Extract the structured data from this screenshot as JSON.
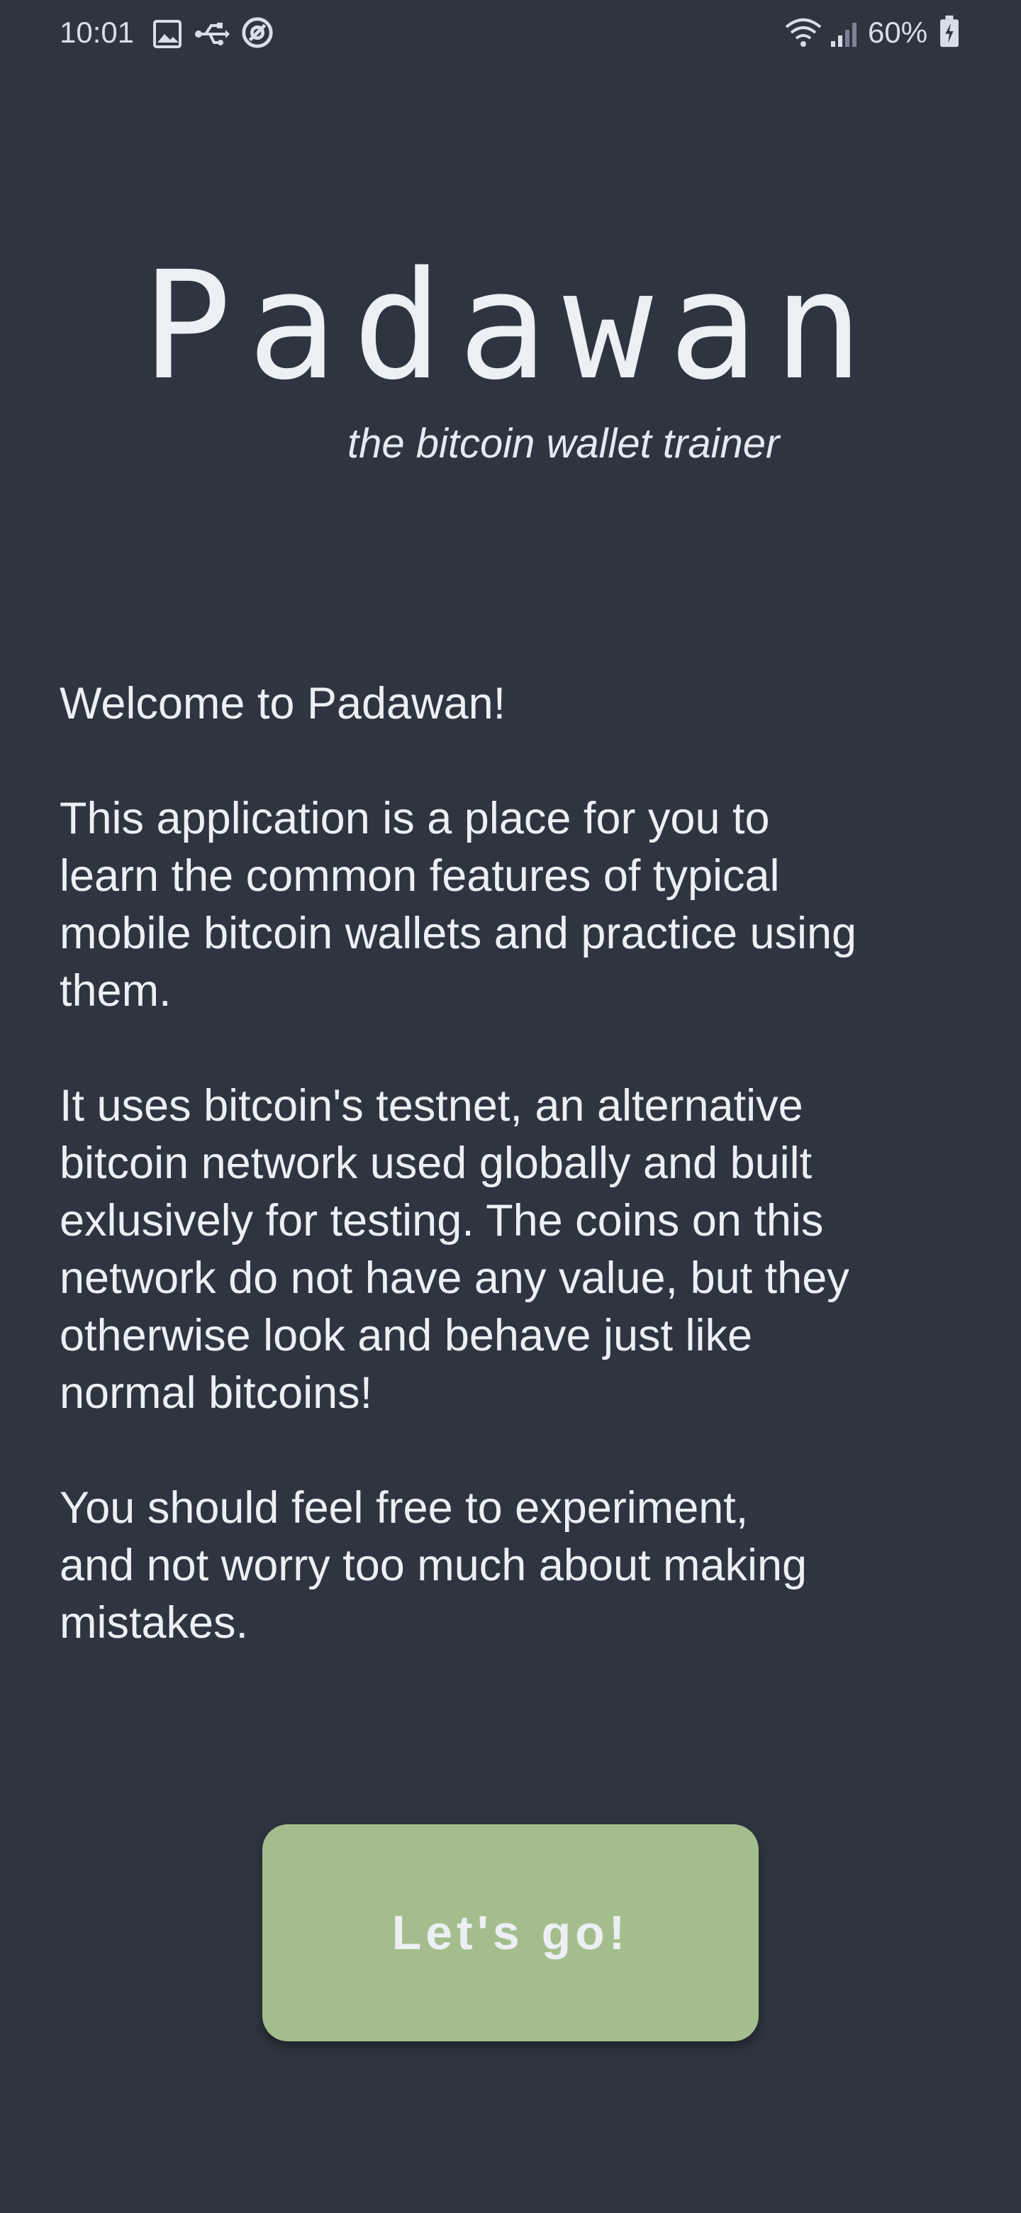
{
  "status_bar": {
    "time": "10:01",
    "battery_percent": "60%",
    "icons_left": [
      "image-icon",
      "usb-icon",
      "sync-icon"
    ],
    "icons_right": [
      "wifi-icon",
      "signal-icon",
      "battery-icon"
    ]
  },
  "header": {
    "title": "Padawan",
    "subtitle": "the bitcoin wallet trainer"
  },
  "intro": {
    "paragraphs": [
      "Welcome to Padawan!",
      "This application is a place for you to\nlearn the common features of typical\nmobile bitcoin wallets and practice using\nthem.",
      "It uses bitcoin's testnet, an alternative\nbitcoin network used globally and built\nexlusively for testing. The coins on this\nnetwork do not have any value, but they\notherwise look and behave just like\nnormal bitcoins!",
      "You should feel free to experiment,\nand not worry too much about making\nmistakes."
    ]
  },
  "cta": {
    "label": "Let's go!"
  },
  "colors": {
    "background": "#2e3440",
    "text": "#eceff4",
    "button": "#a3be8c"
  }
}
